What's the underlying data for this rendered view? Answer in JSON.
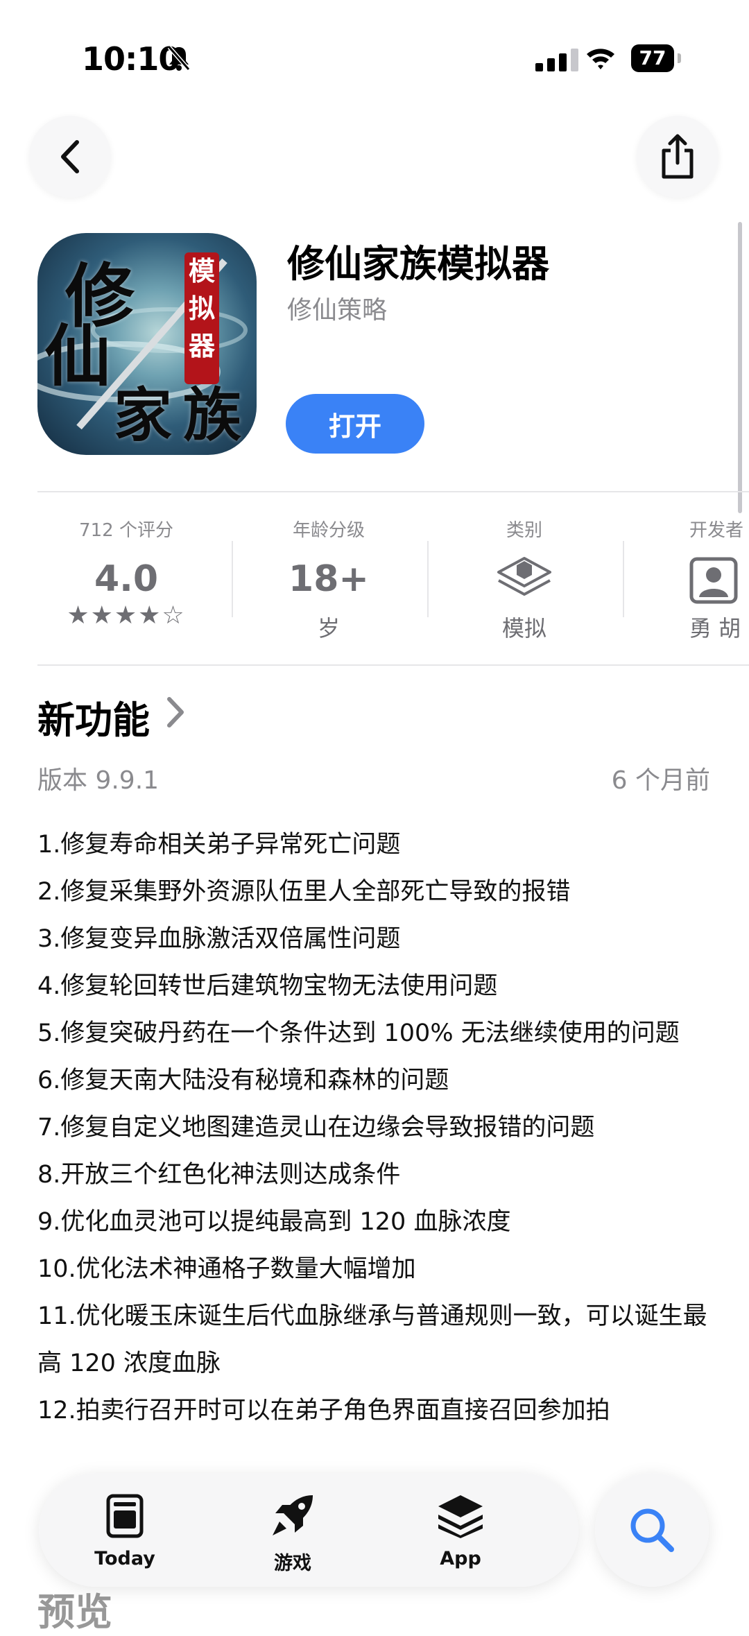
{
  "status_bar": {
    "time": "10:10",
    "battery": "77"
  },
  "app": {
    "title": "修仙家族模拟器",
    "subtitle": "修仙策略",
    "open_label": "打开",
    "icon_text": [
      "修",
      "仙",
      "家",
      "族"
    ],
    "icon_seal": [
      "模",
      "拟",
      "器"
    ]
  },
  "info": {
    "ratings_label": "712 个评分",
    "rating_value": "4.0",
    "stars": "★★★★☆",
    "age_label": "年龄分级",
    "age_value": "18+",
    "age_sub": "岁",
    "category_label": "类别",
    "category_value": "模拟",
    "developer_label": "开发者",
    "developer_value": "勇 胡"
  },
  "whats_new": {
    "title": "新功能",
    "version": "版本 9.9.1",
    "time_ago": "6 个月前",
    "notes": [
      "1.修复寿命相关弟子异常死亡问题",
      "2.修复采集野外资源队伍里人全部死亡导致的报错",
      "3.修复变异血脉激活双倍属性问题",
      "4.修复轮回转世后建筑物宝物无法使用问题",
      "5.修复突破丹药在一个条件达到 100% 无法继续使用的问题",
      "6.修复天南大陆没有秘境和森林的问题",
      "7.修复自定义地图建造灵山在边缘会导致报错的问题",
      "8.开放三个红色化神法则达成条件",
      "9.优化血灵池可以提纯最高到 120 血脉浓度",
      "10.优化法术神通格子数量大幅增加",
      "11.优化暖玉床诞生后代血脉继承与普通规则一致，可以诞生最高 120 浓度血脉",
      "12.拍卖行召开时可以在弟子角色界面直接召回参加拍"
    ]
  },
  "preview": {
    "title": "预览"
  },
  "tab_bar": {
    "today": "Today",
    "games": "游戏",
    "apps": "App"
  },
  "colors": {
    "accent": "#3a82f6",
    "secondary_text": "#8a8a8e"
  }
}
